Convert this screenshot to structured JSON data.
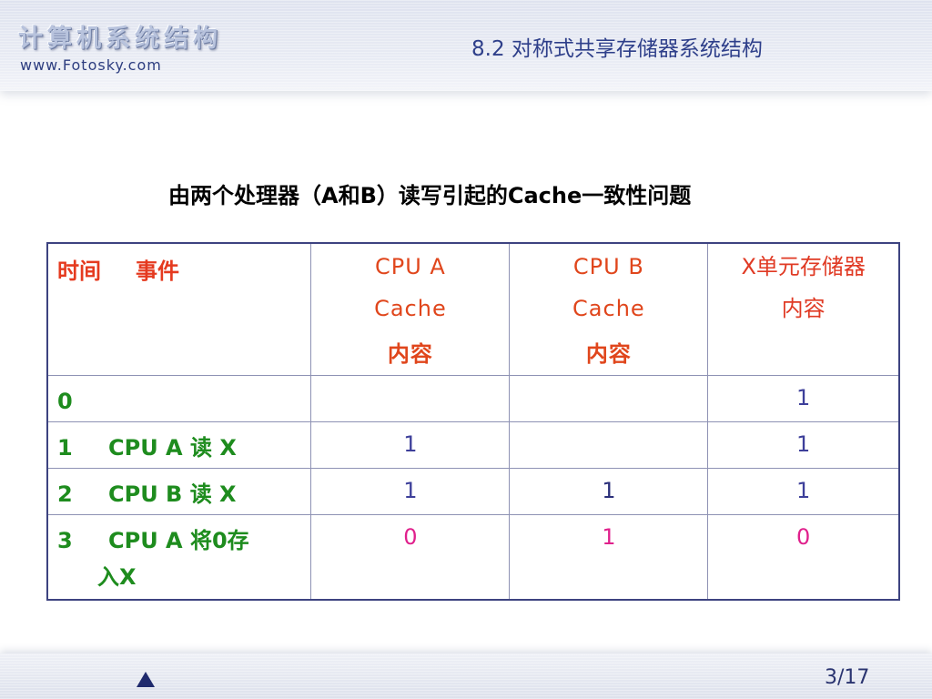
{
  "header": {
    "brand_title": "计算机系统结构",
    "brand_url": "www.Fotosky.com",
    "section_title": "8.2  对称式共享存储器系统结构"
  },
  "caption": "由两个处理器（A和B）读写引起的Cache一致性问题",
  "table": {
    "header": {
      "time": "时间",
      "event": "事件",
      "cpu_a": [
        "CPU A",
        "Cache",
        "内容"
      ],
      "cpu_b": [
        "CPU B",
        "Cache",
        "内容"
      ],
      "memory": [
        "X单元存储器",
        "内容"
      ]
    },
    "rows": [
      {
        "time": "0",
        "event": "",
        "event_cont": "",
        "cpu_a": "",
        "cpu_b": "",
        "memory": "1"
      },
      {
        "time": "1",
        "event": "CPU A 读 X",
        "event_cont": "",
        "cpu_a": "1",
        "cpu_b": "",
        "memory": "1"
      },
      {
        "time": "2",
        "event": "CPU B 读 X",
        "event_cont": "",
        "cpu_a": "1",
        "cpu_b": "1",
        "memory": "1"
      },
      {
        "time": "3",
        "event": "CPU A 将0存",
        "event_cont": "入X",
        "cpu_a": "0",
        "cpu_b": "1",
        "memory": "0"
      }
    ]
  },
  "footer": {
    "page": "3/17",
    "prev_icon": "triangle-up-icon"
  },
  "colors": {
    "header_text": "#e53a1f",
    "event_text": "#1e8c1e",
    "value_text": "#3d3f9a",
    "changed_value": "#e0208c",
    "border": "#3d4380"
  }
}
